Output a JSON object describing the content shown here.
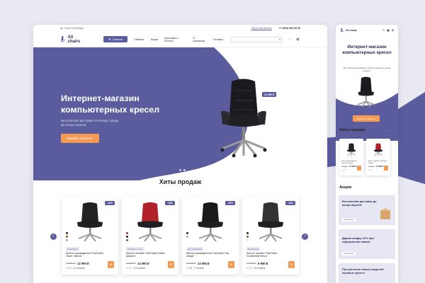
{
  "brand": {
    "name": "All chairs",
    "accent": "#5b5c9e",
    "orange": "#f39a55"
  },
  "topbar": {
    "city": "Санкт-Петербург",
    "link": "Обратный звонок",
    "phone": "+7 (999) 999 99 99"
  },
  "nav": {
    "catalog": "Каталог",
    "items": [
      "Гейминг",
      "Акции",
      "Доставка и оплата",
      "О компании",
      "Отзывы"
    ],
    "search_placeholder": ""
  },
  "hero": {
    "title": "Интернет-магазин компьютерных кресел",
    "subtitle": "Бесплатная доставка по всему городу до конца апреля.",
    "cta": "Перейти в каталог",
    "price": "12 990 ₽"
  },
  "bestsellers": {
    "title": "Хиты продаж"
  },
  "products": [
    {
      "discount": "-10%",
      "stock": "В наличии",
      "name": "Кресло руководителя TopChairs Tower черное",
      "old": "13 990 ₽",
      "price": "12 990 ₽",
      "rating": "4.7",
      "reviews": "12 отзывов",
      "color": "#222"
    },
    {
      "discount": "-15%",
      "stock": "Осталось: 2 шт.",
      "name": "Кресло игровое TopChairs Diablo красное",
      "old": "18 990 ₽",
      "price": "14 990 ₽",
      "rating": "4.7",
      "reviews": "10 отзывов",
      "color": "#b2222a"
    },
    {
      "discount": "-10%",
      "stock": "Нет в наличии",
      "name": "Кресло руководителя TopChairs City серый",
      "old": "16 990 ₽",
      "price": "14 990 ₽",
      "rating": "4.9",
      "reviews": "7 отзывов",
      "color": "#1a1a1a"
    },
    {
      "discount": "-10%",
      "stock": "В наличии",
      "name": "Кресло игровое TopChairs Continental белое",
      "old": "12 990 ₽",
      "price": "9 990 ₽",
      "rating": "4.7",
      "reviews": "15 отзывов",
      "color": "#333"
    }
  ],
  "mobile": {
    "title": "Интернет-магазин компьютерных кресел",
    "subtitle": "Бесплатная доставка по всему городу до конца апреля.",
    "cta": "Перейти в каталог",
    "bestsellers": "Хиты продаж",
    "promos_title": "Акции",
    "promos": [
      {
        "text": "Бесплатная доставка до конца апреля!",
        "more": "Подробнее"
      },
      {
        "text": "Дарим скидку 10% при оформлении заказа",
        "more": "Подробнее"
      },
      {
        "text": "Поступление новых моделей игровых кресел",
        "more": ""
      }
    ],
    "cards": [
      {
        "name": "Кресло руководителя TopChairs Tower",
        "old": "13 990 ₽",
        "price": "12 990 ₽",
        "rating": "4.7"
      },
      {
        "name": "Кресло игровое TopChairs Diablo",
        "old": "18 990 ₽",
        "price": "14 990 ₽",
        "rating": "4.7"
      }
    ]
  }
}
